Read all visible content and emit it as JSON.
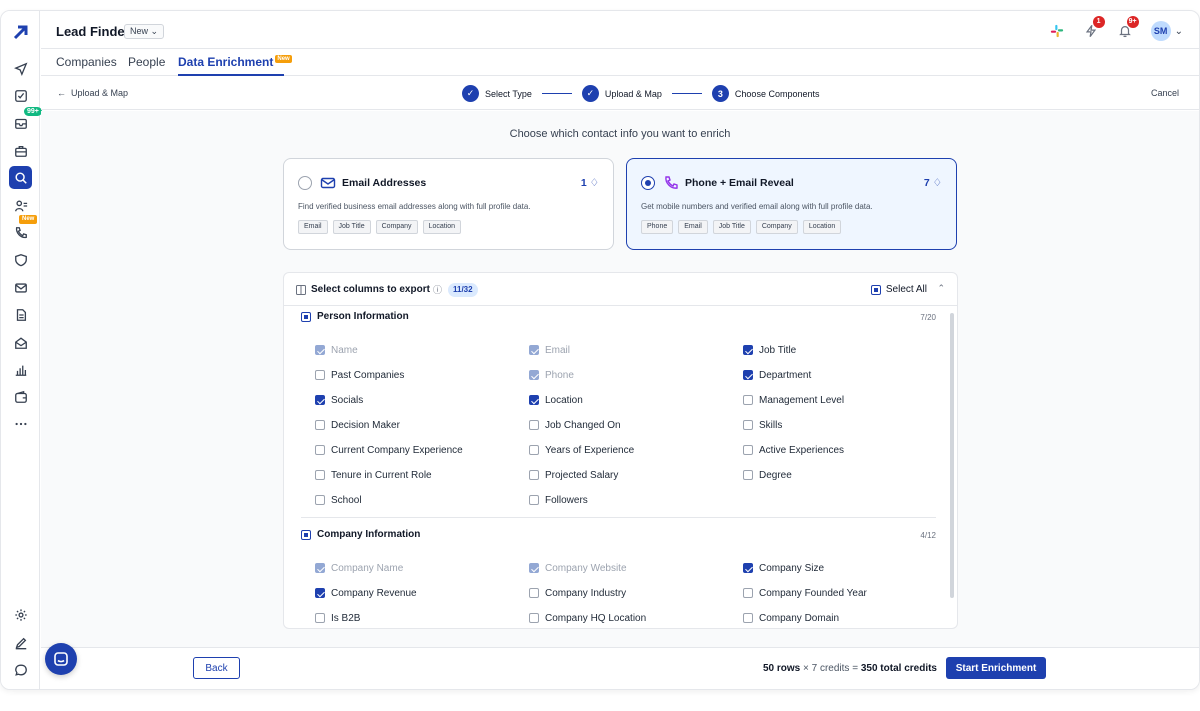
{
  "header": {
    "title": "Lead Finder",
    "badge": "New",
    "notification_count_1": "1",
    "notification_count_2": "9+",
    "avatar": "SM"
  },
  "sidebar": {
    "badge_inbox": "99+",
    "badge_new": "New"
  },
  "tabs": {
    "companies": "Companies",
    "people": "People",
    "data_enrichment": "Data Enrichment",
    "new_badge": "New"
  },
  "stepbar": {
    "back": "Upload & Map",
    "steps": [
      "Select Type",
      "Upload & Map",
      "Choose Components"
    ],
    "step3_number": "3",
    "cancel": "Cancel"
  },
  "main": {
    "subtitle": "Choose which contact info you want to enrich",
    "cards": [
      {
        "title": "Email Addresses",
        "credits": "1",
        "desc": "Find verified business email addresses along with full profile data.",
        "chips": [
          "Email",
          "Job Title",
          "Company",
          "Location"
        ],
        "selected": false
      },
      {
        "title": "Phone + Email Reveal",
        "credits": "7",
        "desc": "Get mobile numbers and verified email along with full profile data.",
        "chips": [
          "Phone",
          "Email",
          "Job Title",
          "Company",
          "Location"
        ],
        "selected": true
      }
    ],
    "columns": {
      "title": "Select columns to export",
      "count": "11/32",
      "select_all": "Select All",
      "person": {
        "title": "Person Information",
        "count": "7/20",
        "fields": [
          {
            "label": "Name",
            "state": "dis"
          },
          {
            "label": "Email",
            "state": "dis"
          },
          {
            "label": "Job Title",
            "state": "on"
          },
          {
            "label": "Past Companies",
            "state": "off"
          },
          {
            "label": "Phone",
            "state": "dis"
          },
          {
            "label": "Department",
            "state": "on"
          },
          {
            "label": "Socials",
            "state": "on"
          },
          {
            "label": "Location",
            "state": "on"
          },
          {
            "label": "Management Level",
            "state": "off"
          },
          {
            "label": "Decision Maker",
            "state": "off"
          },
          {
            "label": "Job Changed On",
            "state": "off"
          },
          {
            "label": "Skills",
            "state": "off"
          },
          {
            "label": "Current Company Experience",
            "state": "off"
          },
          {
            "label": "Years of Experience",
            "state": "off"
          },
          {
            "label": "Active Experiences",
            "state": "off"
          },
          {
            "label": "Tenure in Current Role",
            "state": "off"
          },
          {
            "label": "Projected Salary",
            "state": "off"
          },
          {
            "label": "Degree",
            "state": "off"
          },
          {
            "label": "School",
            "state": "off"
          },
          {
            "label": "Followers",
            "state": "off"
          }
        ]
      },
      "company": {
        "title": "Company Information",
        "count": "4/12",
        "fields": [
          {
            "label": "Company Name",
            "state": "dis"
          },
          {
            "label": "Company Website",
            "state": "dis"
          },
          {
            "label": "Company Size",
            "state": "on"
          },
          {
            "label": "Company Revenue",
            "state": "on"
          },
          {
            "label": "Company Industry",
            "state": "off"
          },
          {
            "label": "Company Founded Year",
            "state": "off"
          },
          {
            "label": "Is B2B",
            "state": "off"
          },
          {
            "label": "Company HQ Location",
            "state": "off"
          },
          {
            "label": "Company Domain",
            "state": "off"
          }
        ]
      }
    }
  },
  "footer": {
    "back": "Back",
    "rows": "50 rows",
    "times": "×",
    "credits": "7 credits",
    "equals": "=",
    "total": "350 total credits",
    "start": "Start Enrichment"
  },
  "colors": {
    "accent": "#1e40af",
    "accent_light": "#eff6ff",
    "badge_red": "#dc2626",
    "badge_orange": "#f59e0b",
    "badge_green": "#10b981"
  },
  "icons": [
    "logo-icon",
    "send-icon",
    "check-square-icon",
    "inbox-icon",
    "briefcase-icon",
    "search-icon",
    "users-icon",
    "phone-icon",
    "shield-icon",
    "mail-icon",
    "document-icon",
    "mail-open-icon",
    "bar-chart-icon",
    "wallet-icon",
    "more-icon",
    "settings-icon",
    "edit-icon",
    "chat-icon",
    "slack-icon",
    "lightning-icon",
    "bell-icon"
  ]
}
